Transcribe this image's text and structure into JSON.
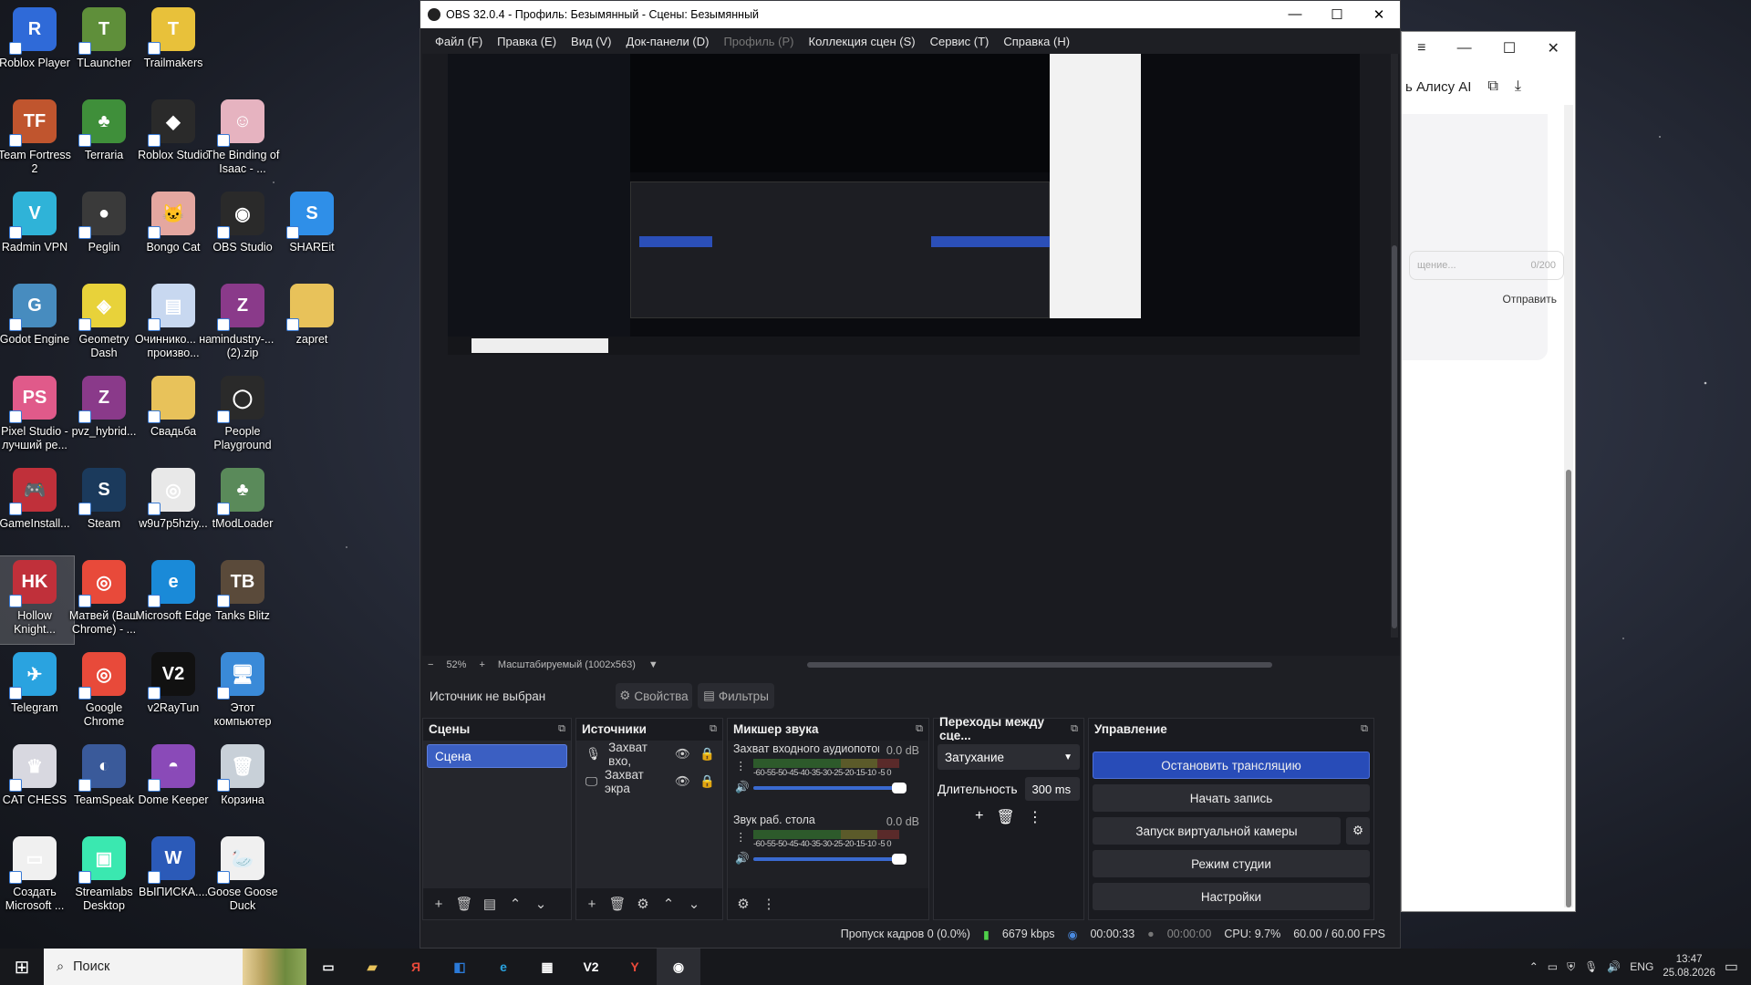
{
  "desktop": {
    "icons": [
      {
        "label": "Roblox Player",
        "icon": "roblox-player-icon",
        "color": "#2f6ad8",
        "glyph": "R"
      },
      {
        "label": "TLauncher",
        "icon": "tlauncher-icon",
        "color": "#5f8f3a",
        "glyph": "T"
      },
      {
        "label": "Trailmakers",
        "icon": "trailmakers-icon",
        "color": "#e8c13a",
        "glyph": "T"
      },
      {
        "label": "Team Fortress 2",
        "icon": "team-fortress-icon",
        "color": "#c0552e",
        "glyph": "TF"
      },
      {
        "label": "Terraria",
        "icon": "terraria-icon",
        "color": "#3f8f3a",
        "glyph": "♣"
      },
      {
        "label": "Roblox Studio",
        "icon": "roblox-studio-icon",
        "color": "#2a2a2a",
        "glyph": "◆"
      },
      {
        "label": "The Binding of Isaac - ...",
        "icon": "isaac-icon",
        "color": "#e6b3c0",
        "glyph": "☺"
      },
      {
        "label": "Radmin VPN",
        "icon": "radmin-vpn-icon",
        "color": "#2fb3d8",
        "glyph": "V"
      },
      {
        "label": "Peglin",
        "icon": "peglin-icon",
        "color": "#3a3a3a",
        "glyph": "●"
      },
      {
        "label": "Bongo Cat",
        "icon": "bongo-cat-icon",
        "color": "#e4a7a0",
        "glyph": "🐱"
      },
      {
        "label": "OBS Studio",
        "icon": "obs-studio-icon",
        "color": "#2a2a2a",
        "glyph": "◉"
      },
      {
        "label": "SHAREit",
        "icon": "shareit-icon",
        "color": "#2f8fe8",
        "glyph": "S"
      },
      {
        "label": "Godot Engine",
        "icon": "godot-icon",
        "color": "#478cbf",
        "glyph": "G"
      },
      {
        "label": "Geometry Dash",
        "icon": "geometry-dash-icon",
        "color": "#e8d23a",
        "glyph": "◈"
      },
      {
        "label": "Очиннико... на произво...",
        "icon": "pdf-file-icon",
        "color": "#c8d8f0",
        "glyph": "▤"
      },
      {
        "label": "mindustry-... (2).zip",
        "icon": "winrar-icon",
        "color": "#8a3a8a",
        "glyph": "Z"
      },
      {
        "label": "zapret",
        "icon": "folder-icon",
        "color": "#e8c25a",
        "glyph": ""
      },
      {
        "label": "Pixel Studio - лучший ре...",
        "icon": "pixel-studio-icon",
        "color": "#e05a8a",
        "glyph": "PS"
      },
      {
        "label": "pvz_hybrid...",
        "icon": "winrar-icon",
        "color": "#8a3a8a",
        "glyph": "Z"
      },
      {
        "label": "Свадьба",
        "icon": "folder-icon",
        "color": "#e8c25a",
        "glyph": ""
      },
      {
        "label": "People Playground",
        "icon": "people-playground-icon",
        "color": "#2a2a2a",
        "glyph": "◯"
      },
      {
        "label": "GameInstall...",
        "icon": "gameinstall-icon",
        "color": "#c0303a",
        "glyph": "🎮"
      },
      {
        "label": "Steam",
        "icon": "steam-icon",
        "color": "#1b3a5c",
        "glyph": "S"
      },
      {
        "label": "w9u7p5hziy...",
        "icon": "chrome-icon",
        "color": "#e8e8e8",
        "glyph": "◎"
      },
      {
        "label": "tModLoader",
        "icon": "tmodloader-icon",
        "color": "#5a8a5a",
        "glyph": "♣"
      },
      {
        "label": "Hollow Knight...",
        "icon": "hollow-knight-icon",
        "color": "#c0303a",
        "glyph": "HK"
      },
      {
        "label": "Матвей (Ваш Chrome) - ...",
        "icon": "chrome-icon",
        "color": "#e84a3a",
        "glyph": "◎"
      },
      {
        "label": "Microsoft Edge",
        "icon": "edge-icon",
        "color": "#1a8ad8",
        "glyph": "e"
      },
      {
        "label": "Tanks Blitz",
        "icon": "tanks-blitz-icon",
        "color": "#5a4a3a",
        "glyph": "TB"
      },
      {
        "label": "Telegram",
        "icon": "telegram-icon",
        "color": "#2aa3e0",
        "glyph": "✈"
      },
      {
        "label": "Google Chrome",
        "icon": "chrome-icon",
        "color": "#e84a3a",
        "glyph": "◎"
      },
      {
        "label": "v2RayTun",
        "icon": "v2raytun-icon",
        "color": "#111",
        "glyph": "V2"
      },
      {
        "label": "Этот компьютер",
        "icon": "this-pc-icon",
        "color": "#3a8ad8",
        "glyph": "🖥"
      },
      {
        "label": "CAT CHESS",
        "icon": "cat-chess-icon",
        "color": "#d8d8e0",
        "glyph": "♛"
      },
      {
        "label": "TeamSpeak",
        "icon": "teamspeak-icon",
        "color": "#3a5a9a",
        "glyph": "◐"
      },
      {
        "label": "Dome Keeper",
        "icon": "dome-keeper-icon",
        "color": "#8a4ab8",
        "glyph": "◓"
      },
      {
        "label": "Корзина",
        "icon": "recycle-bin-icon",
        "color": "#c8d0d8",
        "glyph": "🗑"
      },
      {
        "label": "Создать Microsoft ...",
        "icon": "create-doc-icon",
        "color": "#f0f0f0",
        "glyph": "▭"
      },
      {
        "label": "Streamlabs Desktop",
        "icon": "streamlabs-icon",
        "color": "#3ae8b0",
        "glyph": "▣"
      },
      {
        "label": "ВЫПИСКА....",
        "icon": "word-icon",
        "color": "#2b5ab8",
        "glyph": "W"
      },
      {
        "label": "Goose Goose Duck",
        "icon": "goose-goose-duck-icon",
        "color": "#f0f0f0",
        "glyph": "🦢"
      }
    ]
  },
  "browser": {
    "toolbar_text": "ь Алису AI",
    "input_placeholder": "щение...",
    "counter": "0/200",
    "send_label": "Отправить"
  },
  "obs": {
    "title": "OBS 32.0.4 - Профиль: Безымянный - Сцены: Безымянный",
    "menu": [
      "Файл (F)",
      "Правка (E)",
      "Вид (V)",
      "Док-панели (D)",
      "Профиль (P)",
      "Коллекция сцен (S)",
      "Сервис (T)",
      "Справка (H)"
    ],
    "zoom": {
      "percent": "52%",
      "mode": "Масштабируемый (1002x563)"
    },
    "source_bar": {
      "no_source": "Источник не выбран",
      "properties": "Свойства",
      "filters": "Фильтры"
    },
    "docks": {
      "scenes": {
        "title": "Сцены",
        "items": [
          "Сцена"
        ]
      },
      "sources": {
        "title": "Источники",
        "items": [
          "Захват вхо,",
          "Захват экра"
        ]
      },
      "mixer": {
        "title": "Микшер звука",
        "channels": [
          {
            "name": "Захват входного аудиопотока",
            "db": "0.0 dB"
          },
          {
            "name": "Звук раб. стола",
            "db": "0.0 dB"
          }
        ],
        "ticks": "-60-55-50-45-40-35-30-25-20-15-10 -5  0"
      },
      "transitions": {
        "title": "Переходы между сце...",
        "selected": "Затухание",
        "duration_label": "Длительность",
        "duration_value": "300 ms"
      },
      "controls": {
        "title": "Управление",
        "buttons": [
          "Остановить трансляцию",
          "Начать запись",
          "Запуск виртуальной камеры",
          "Режим студии",
          "Настройки"
        ]
      }
    },
    "status": {
      "dropped": "Пропуск кадров 0 (0.0%)",
      "bitrate": "6679 kbps",
      "stream_time": "00:00:33",
      "rec_time": "00:00:00",
      "cpu": "CPU: 9.7%",
      "fps": "60.00 / 60.00 FPS"
    }
  },
  "taskbar": {
    "search_label": "Поиск",
    "lang": "ENG",
    "time": "13:47",
    "date": "25.08.2026"
  }
}
